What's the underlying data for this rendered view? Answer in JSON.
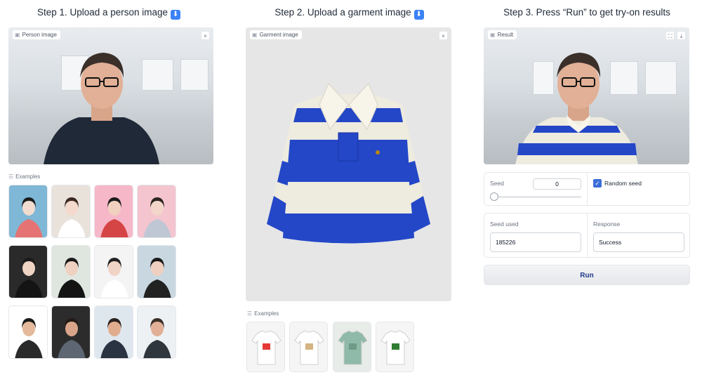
{
  "steps": {
    "step1_title": "Step 1. Upload a person image",
    "step2_title": "Step 2. Upload a garment image",
    "step3_title": "Step 3. Press “Run” to get try-on results",
    "arrow_glyph": "⬇"
  },
  "person_panel": {
    "label": "Person image",
    "close_glyph": "×"
  },
  "garment_panel": {
    "label": "Garment image",
    "close_glyph": "×"
  },
  "result_panel": {
    "label": "Result",
    "fullscreen_glyph": "⛶",
    "download_glyph": "⤓"
  },
  "person_examples": {
    "label": "Examples",
    "count": 12
  },
  "garment_examples": {
    "label": "Examples",
    "count": 4
  },
  "seed": {
    "label": "Seed",
    "value": "0",
    "slider_fraction": 0.0
  },
  "random_seed": {
    "label": "Random seed",
    "checked": true
  },
  "seed_used": {
    "label": "Seed used",
    "value": "185226"
  },
  "response": {
    "label": "Response",
    "value": "Success"
  },
  "run_button": {
    "label": "Run"
  },
  "colors": {
    "accent_blue": "#2447c8",
    "checkbox_blue": "#3b6fd8",
    "run_text": "#1e3a8a"
  },
  "icons": [
    "image-icon",
    "close-icon",
    "fullscreen-icon",
    "download-icon",
    "menu-icon",
    "checkmark-icon",
    "arrow-down-icon"
  ]
}
